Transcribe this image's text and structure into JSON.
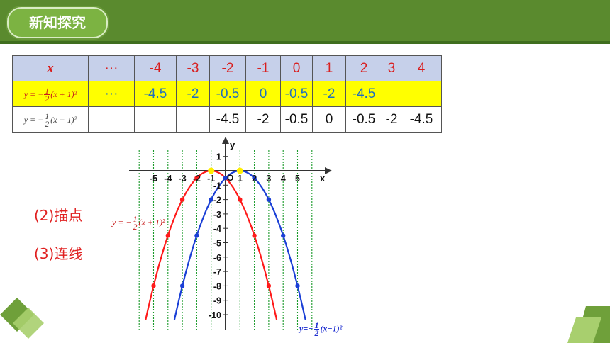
{
  "header": {
    "title": "新知探究"
  },
  "table": {
    "x_row": {
      "label": "x",
      "cells": [
        "···",
        "-4",
        "-3",
        "-2",
        "-1",
        "0",
        "1",
        "2",
        "3",
        "4"
      ]
    },
    "y1_row": {
      "formula": {
        "lhs": "y = −",
        "num": "1",
        "den": "2",
        "body": "(x + 1)²"
      },
      "cells": [
        "···",
        "-4.5",
        "-2",
        "-0.5",
        "0",
        "-0.5",
        "-2",
        "-4.5",
        "",
        ""
      ]
    },
    "y2_row": {
      "formula": {
        "lhs": "y = −",
        "num": "1",
        "den": "2",
        "body": "(x − 1)²"
      },
      "cells": [
        "",
        "",
        "",
        "-4.5",
        "-2",
        "-0.5",
        "0",
        "-0.5",
        "-2",
        "-4.5"
      ]
    }
  },
  "steps": {
    "plot": "(2)描点",
    "connect": "(3)连线"
  },
  "graph": {
    "x_axis_label": "x",
    "y_axis_label": "y",
    "origin_label": "O",
    "x_ticks": [
      "-5",
      "-4",
      "-3",
      "-2",
      "-1",
      "1",
      "2",
      "3",
      "4",
      "5"
    ],
    "y_ticks": [
      "1",
      "-1",
      "-2",
      "-3",
      "-4",
      "-5",
      "-6",
      "-7",
      "-8",
      "-9",
      "-10"
    ],
    "red_label": {
      "lhs": "y = −",
      "num": "1",
      "den": "2",
      "body": "(x + 1)²"
    },
    "blue_label": {
      "lhs": "y=−",
      "num": "1",
      "den": "2",
      "body": "(x−1)²"
    },
    "colors": {
      "red": "#ff1a1a",
      "blue": "#1a3fd6",
      "vertex": "#ffee00",
      "grid": "#1a9a2a"
    }
  },
  "chart_data": {
    "type": "line",
    "xlabel": "x",
    "ylabel": "y",
    "xlim": [
      -5,
      5
    ],
    "ylim": [
      -10,
      1
    ],
    "series": [
      {
        "name": "y = −1/2(x + 1)²",
        "points": [
          [
            -4,
            -4.5
          ],
          [
            -3,
            -2
          ],
          [
            -2,
            -0.5
          ],
          [
            -1,
            0
          ],
          [
            0,
            -0.5
          ],
          [
            1,
            -2
          ],
          [
            2,
            -4.5
          ],
          [
            3,
            -8
          ]
        ],
        "extra_points": [
          [
            -5,
            -8
          ]
        ]
      },
      {
        "name": "y = −1/2(x − 1)²",
        "points": [
          [
            -2,
            -4.5
          ],
          [
            -1,
            -2
          ],
          [
            0,
            -0.5
          ],
          [
            1,
            0
          ],
          [
            2,
            -0.5
          ],
          [
            3,
            -2
          ],
          [
            4,
            -4.5
          ],
          [
            5,
            -8
          ]
        ],
        "extra_points": [
          [
            -3,
            -8
          ]
        ]
      }
    ]
  }
}
